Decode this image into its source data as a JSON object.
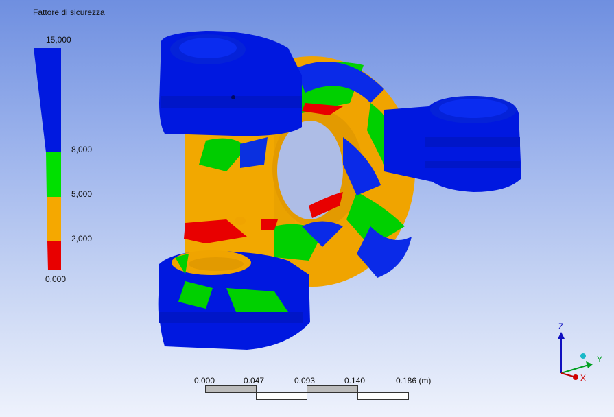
{
  "legend": {
    "title": "Fattore di sicurezza",
    "labels": [
      "15,000",
      "8,000",
      "5,000",
      "2,000",
      "0,000"
    ],
    "colors": {
      "high": "#0019e0",
      "mid_high": "#00e000",
      "mid_low": "#f5a800",
      "low": "#e80000"
    }
  },
  "scale_bar": {
    "ticks": [
      "0.000",
      "0.047",
      "0.093",
      "0.140",
      "0.186 (m)"
    ]
  },
  "triad": {
    "z": "Z",
    "y": "Y",
    "x": "X"
  }
}
